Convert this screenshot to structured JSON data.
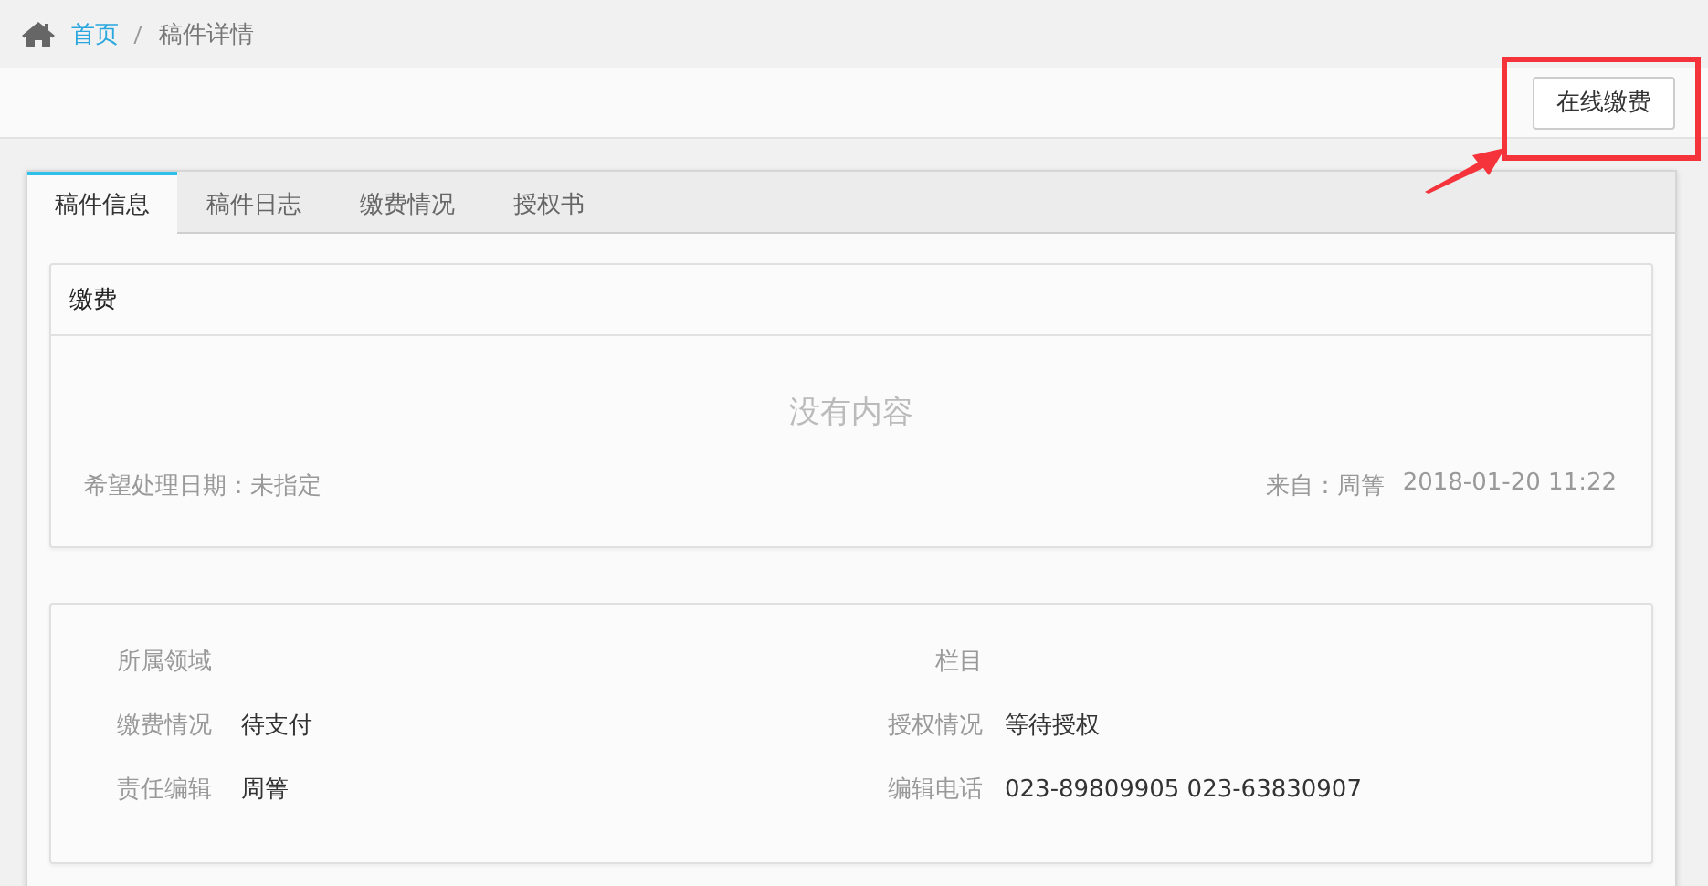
{
  "breadcrumb": [
    {
      "label": "首页",
      "link": true
    },
    {
      "label": "稿件详情",
      "link": false
    }
  ],
  "toolbar": {
    "button": "在线缴费",
    "highlighted": true
  },
  "tabs": [
    {
      "label": "稿件信息",
      "selected": true
    },
    {
      "label": "稿件日志",
      "selected": false
    },
    {
      "label": "缴费情况",
      "selected": false
    },
    {
      "label": "授权书",
      "selected": false
    }
  ],
  "payment_card": {
    "title": "缴费",
    "empty_text": "没有内容",
    "due_date": "希望处理日期：未指定",
    "from": "来自：周箐",
    "time": "2018-01-20 11:22"
  },
  "info_fields": [
    {
      "label": "所属领域"
    },
    {
      "label": "栏目"
    },
    {
      "label": "缴费情况",
      "value": "待支付"
    },
    {
      "label": "授权情况",
      "value": "等待授权"
    },
    {
      "label": "责任编辑",
      "value": "周箐"
    },
    {
      "label": "编辑电话",
      "value": "023-89809905 023-63830907"
    }
  ]
}
